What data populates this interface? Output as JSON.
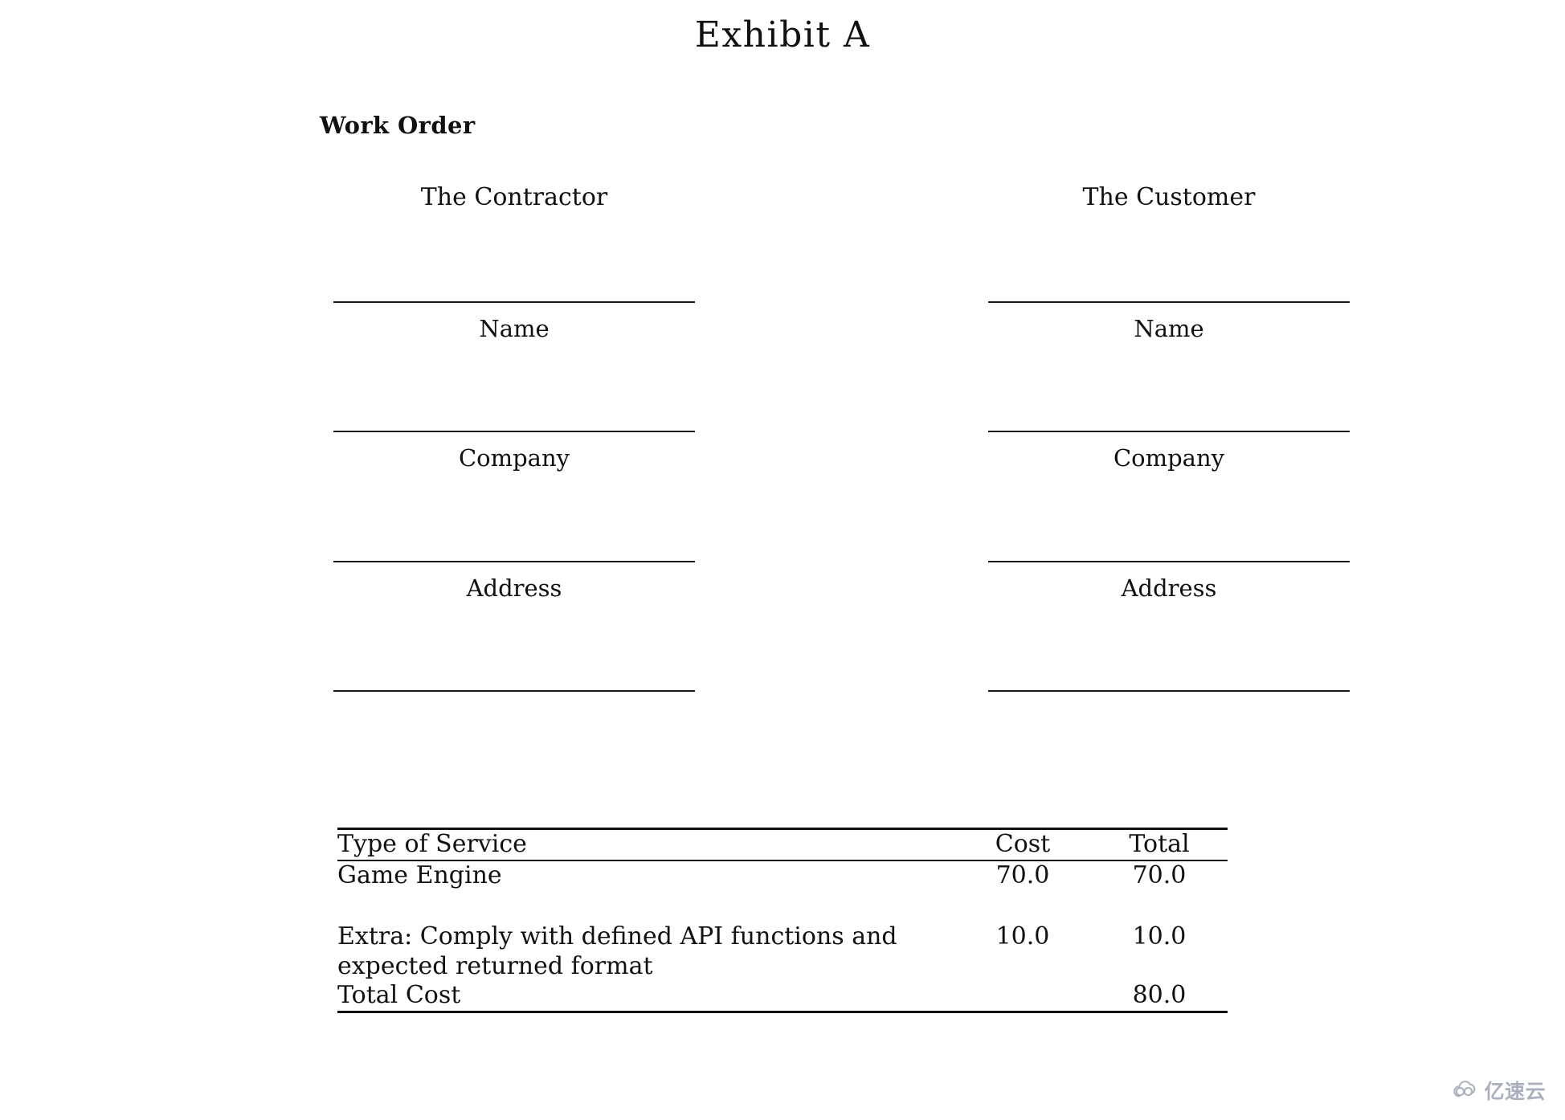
{
  "document": {
    "title": "Exhibit A",
    "section_heading": "Work Order"
  },
  "parties": [
    {
      "title": "The Contractor",
      "fields": [
        {
          "label": "Name"
        },
        {
          "label": "Company"
        },
        {
          "label": "Address"
        },
        {
          "label": ""
        }
      ]
    },
    {
      "title": "The Customer",
      "fields": [
        {
          "label": "Name"
        },
        {
          "label": "Company"
        },
        {
          "label": "Address"
        },
        {
          "label": ""
        }
      ]
    }
  ],
  "cost_table": {
    "columns": [
      {
        "key": "service",
        "label": "Type of Service",
        "align": "left"
      },
      {
        "key": "cost",
        "label": "Cost",
        "align": "center"
      },
      {
        "key": "total",
        "label": "Total",
        "align": "center"
      }
    ],
    "rows": [
      {
        "service": "Game Engine",
        "cost": "70.0",
        "total": "70.0"
      },
      {
        "service": "Extra: Comply with defined API functions and expected returned format",
        "cost": "10.0",
        "total": "10.0"
      }
    ],
    "total_row": {
      "label": "Total Cost",
      "cost": "",
      "total": "80.0"
    }
  },
  "watermark": {
    "text": "亿速云",
    "icon": "cloud-icon",
    "color": "#8b93a3"
  }
}
